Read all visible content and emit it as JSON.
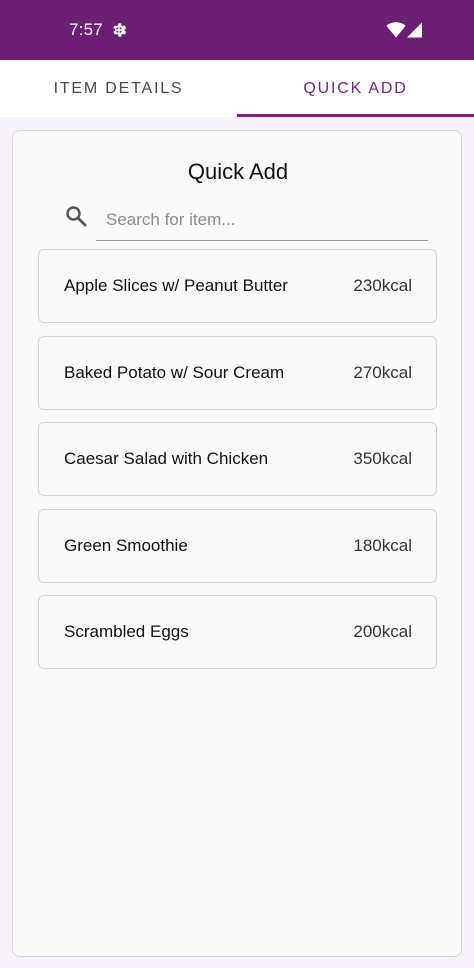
{
  "status_bar": {
    "time": "7:57",
    "icons": [
      "gear-icon",
      "wifi-icon",
      "cell-signal-icon"
    ],
    "background": "#6b1f73"
  },
  "tabs": [
    {
      "label": "ITEM DETAILS",
      "selected": false
    },
    {
      "label": "QUICK ADD",
      "selected": true
    }
  ],
  "accent_color": "#7a1f86",
  "quick_add": {
    "title": "Quick Add",
    "search": {
      "placeholder": "Search for item...",
      "value": ""
    },
    "items": [
      {
        "name": "Apple Slices w/ Peanut Butter",
        "calories": "230kcal"
      },
      {
        "name": "Baked Potato w/ Sour Cream",
        "calories": "270kcal"
      },
      {
        "name": "Caesar Salad with Chicken",
        "calories": "350kcal"
      },
      {
        "name": "Green Smoothie",
        "calories": "180kcal"
      },
      {
        "name": "Scrambled Eggs",
        "calories": "200kcal"
      }
    ]
  }
}
